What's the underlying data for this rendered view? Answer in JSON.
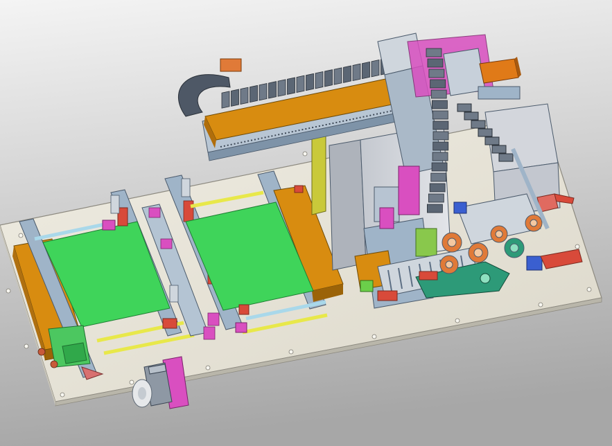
{
  "viewport": {
    "background_top": "#f4f4f4",
    "background_bottom": "#a7a7a7"
  },
  "palette": {
    "base_plate": "#e9e5d8",
    "base_edge": "#8d8a80",
    "steel_blue": "#9fb4c8",
    "steel_dark": "#5d6f84",
    "orange": "#d88c10",
    "orange_dark": "#9b6308",
    "green_panel": "#3fd45a",
    "magenta": "#d94fc0",
    "yellow": "#e8e84a",
    "olive_yellow": "#c9c93a",
    "red": "#d84a3a",
    "cabinet_grey": "#d3d6dc",
    "teal_green": "#2d9a78",
    "chain_dark": "#4e5866"
  },
  "components": [
    "base-plate",
    "gantry-beam",
    "cable-chain",
    "vertical-cable-chain",
    "left-conveyor",
    "right-conveyor",
    "control-cabinet",
    "pick-head",
    "stepper-motor",
    "rollers"
  ]
}
